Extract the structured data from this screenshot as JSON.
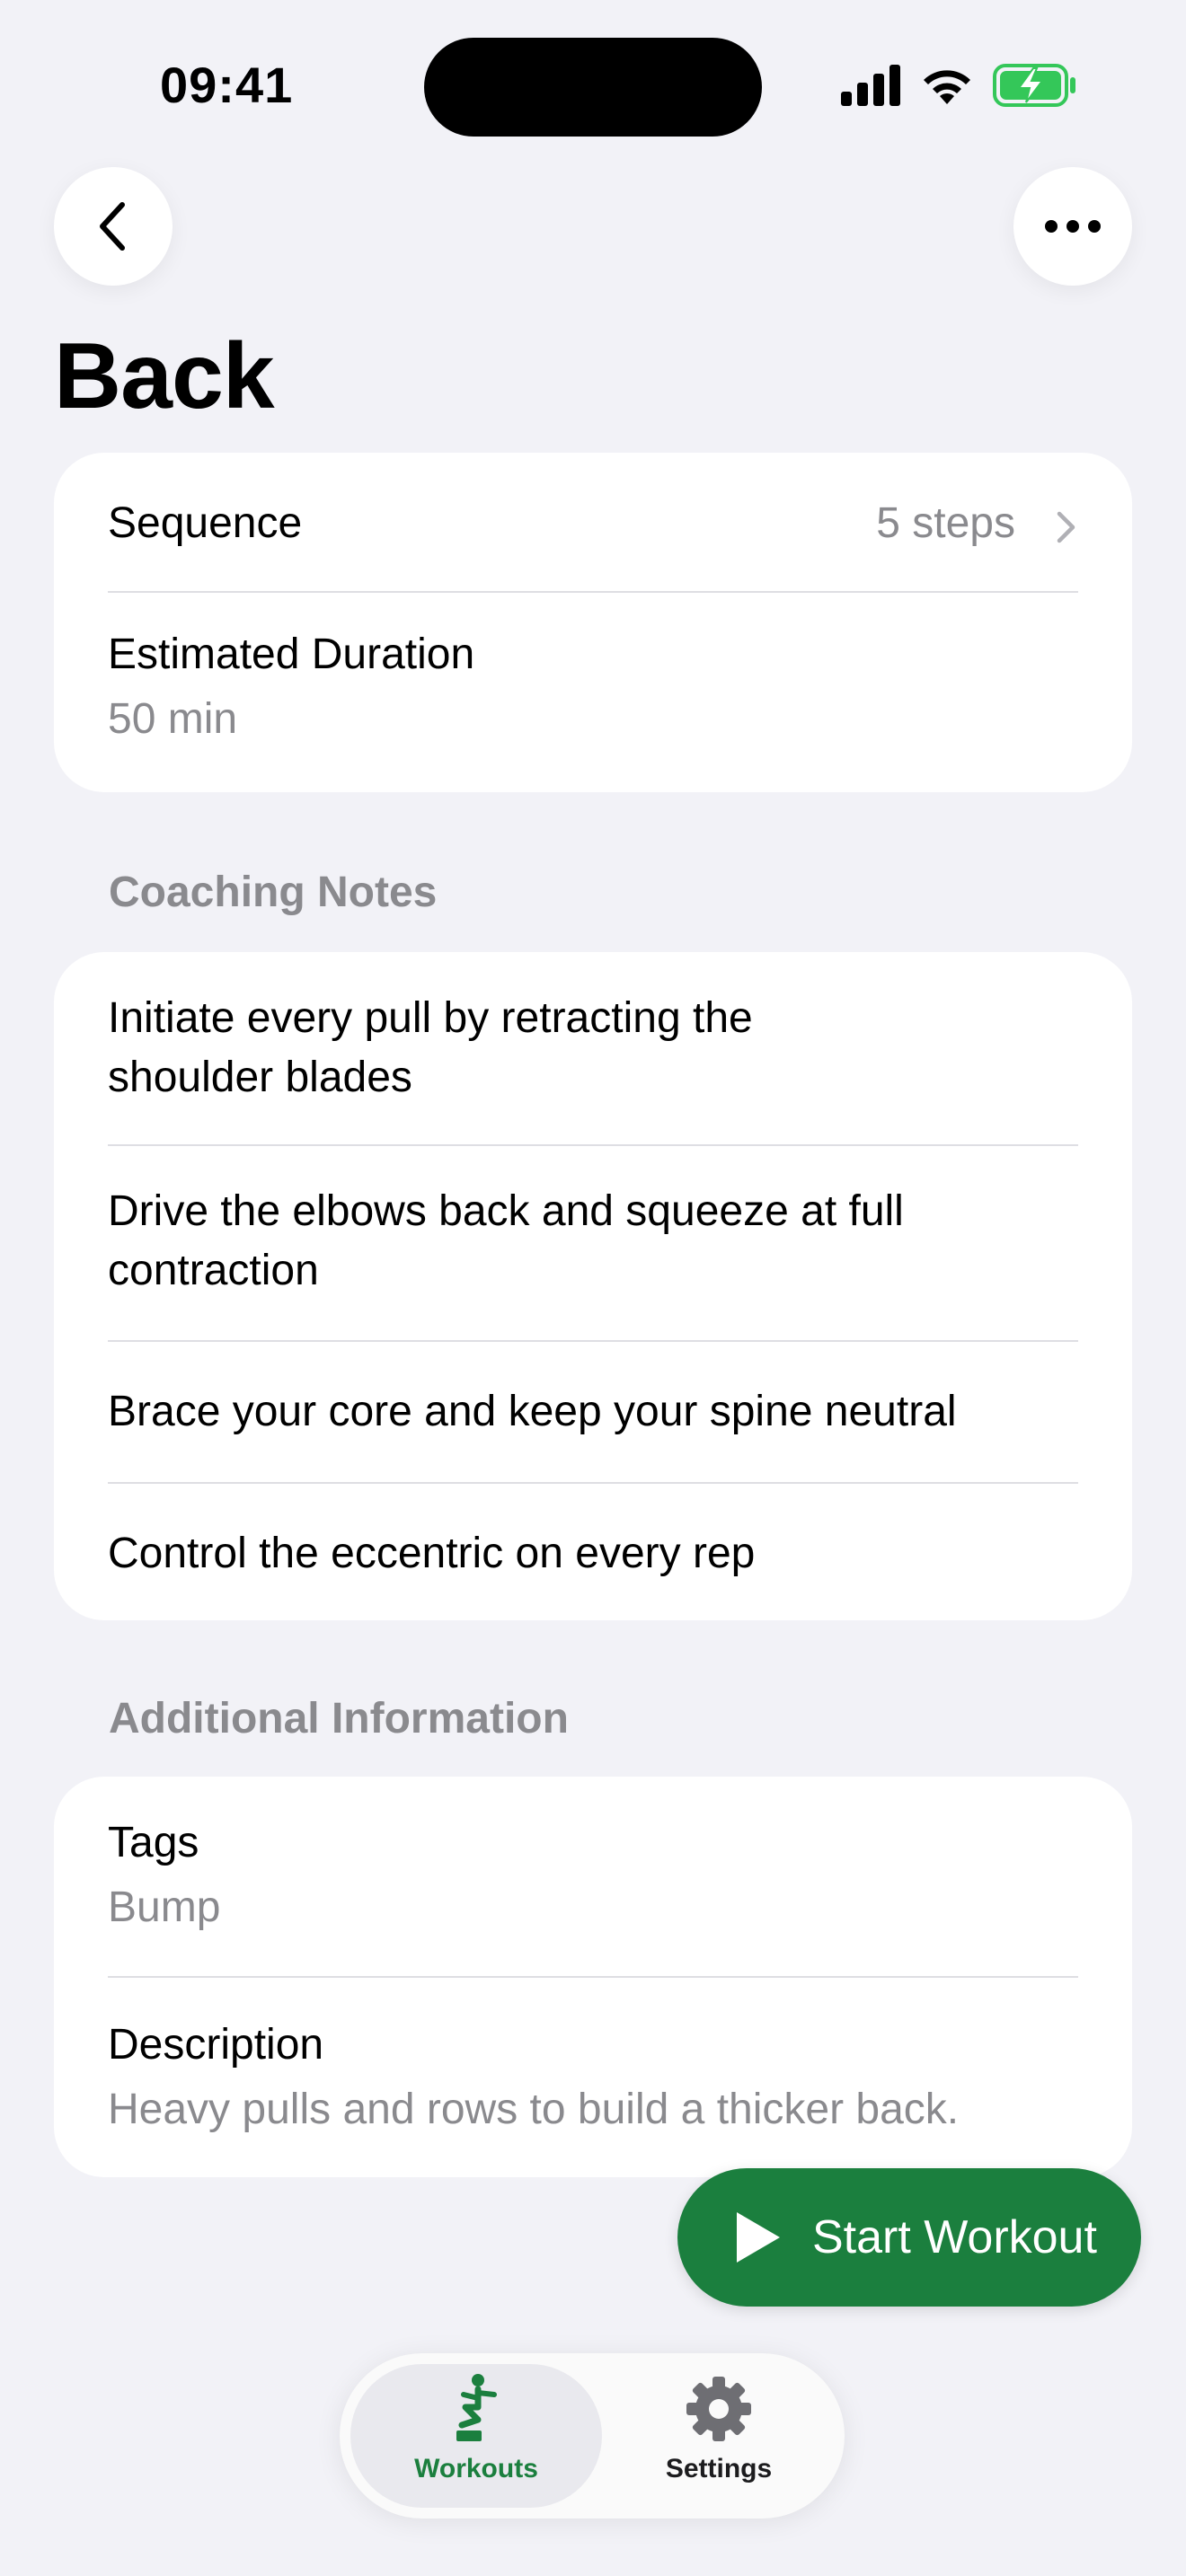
{
  "status_bar": {
    "time": "09:41"
  },
  "nav": {
    "title": "Back"
  },
  "summary": {
    "sequence_label": "Sequence",
    "sequence_value": "5 steps",
    "duration_label": "Estimated Duration",
    "duration_value": "50 min"
  },
  "coaching": {
    "header": "Coaching Notes",
    "notes": [
      {
        "line1": "Initiate every pull by retracting the",
        "line2": "shoulder blades"
      },
      {
        "line1": "Drive the elbows back and squeeze at full",
        "line2": "contraction"
      },
      {
        "line1": "Brace your core and keep your spine neutral"
      },
      {
        "line1": "Control the eccentric on every rep"
      }
    ]
  },
  "additional": {
    "header": "Additional Information",
    "tags_label": "Tags",
    "tags_value": "Bump",
    "description_label": "Description",
    "description_value": "Heavy pulls and rows to build a thicker back."
  },
  "actions": {
    "start_label": "Start Workout"
  },
  "tabbar": {
    "tabs": [
      {
        "label": "Workouts",
        "icon": "workout-figure-icon",
        "selected": true
      },
      {
        "label": "Settings",
        "icon": "gear-icon",
        "selected": false
      }
    ]
  },
  "colors": {
    "accent": "#1b7f3e",
    "battery": "#34c759",
    "background": "#f2f2f7"
  }
}
